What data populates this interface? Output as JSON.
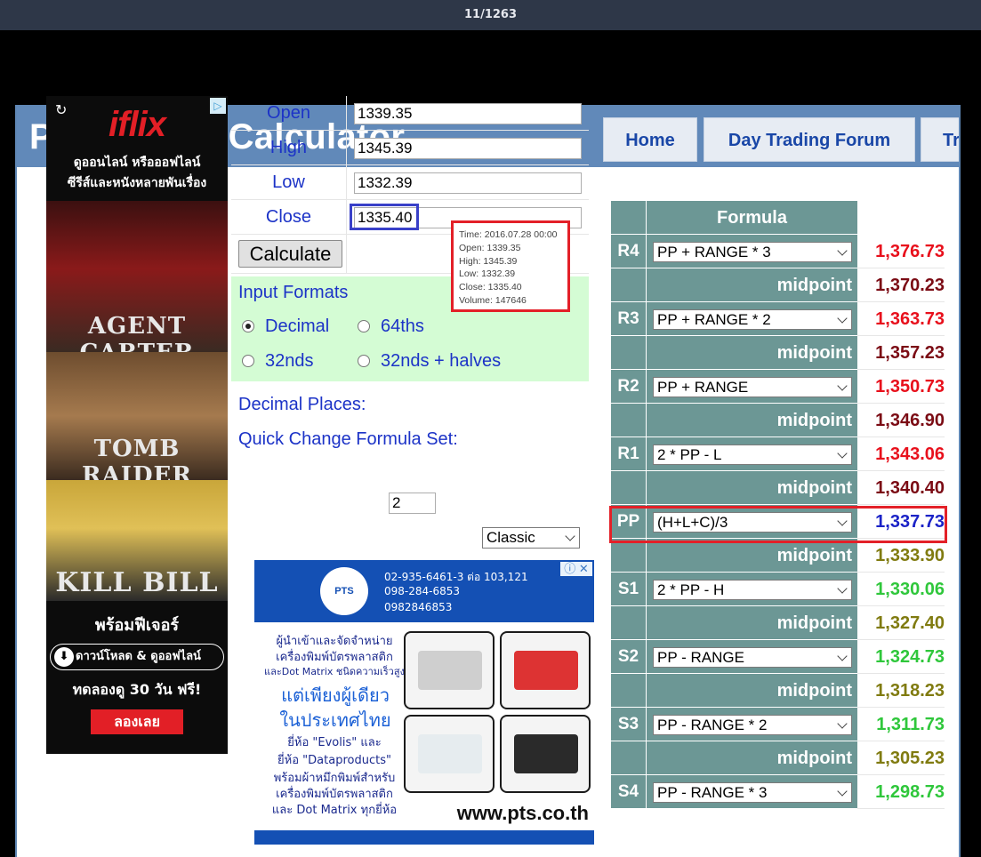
{
  "viewer": {
    "counter": "11/1263"
  },
  "site": {
    "title": "Pivot Point Calculator",
    "nav": [
      "Home",
      "Day Trading Forum",
      "Tr"
    ]
  },
  "inputs": {
    "open_label": "Open",
    "open_value": "1339.35",
    "high_label": "High",
    "high_value": "1345.39",
    "low_label": "Low",
    "low_value": "1332.39",
    "close_label": "Close",
    "close_value": "1335.40",
    "calculate_label": "Calculate"
  },
  "formats": {
    "title": "Input Formats",
    "options": [
      "Decimal",
      "64ths",
      "32nds",
      "32nds + halves"
    ],
    "selected": "Decimal",
    "decimal_places_label": "Decimal Places:",
    "decimal_places_value": "2",
    "quick_change_label": "Quick Change Formula Set:",
    "quick_change_value": "Classic"
  },
  "tooltip": {
    "time": "Time: 2016.07.28 00:00",
    "open": "Open: 1339.35",
    "high": "High: 1345.39",
    "low": "Low:  1332.39",
    "close": "Close: 1335.40",
    "volume": "Volume: 147646"
  },
  "pivot": {
    "header": "Formula",
    "midpoint_label": "midpoint",
    "rows": [
      {
        "key": "R4",
        "formula": "PP + RANGE * 3",
        "value": "1,376.73",
        "color": "#e8101c"
      },
      {
        "key": "",
        "formula": "",
        "value": "1,370.23",
        "color": "#7b0b14"
      },
      {
        "key": "R3",
        "formula": "PP + RANGE * 2",
        "value": "1,363.73",
        "color": "#e8101c"
      },
      {
        "key": "",
        "formula": "",
        "value": "1,357.23",
        "color": "#7b0b14"
      },
      {
        "key": "R2",
        "formula": "PP + RANGE",
        "value": "1,350.73",
        "color": "#e8101c"
      },
      {
        "key": "",
        "formula": "",
        "value": "1,346.90",
        "color": "#7b0b14"
      },
      {
        "key": "R1",
        "formula": "2 * PP - L",
        "value": "1,343.06",
        "color": "#e8101c"
      },
      {
        "key": "",
        "formula": "",
        "value": "1,340.40",
        "color": "#7b0b14"
      },
      {
        "key": "PP",
        "formula": "(H+L+C)/3",
        "value": "1,337.73",
        "color": "#1b23c7"
      },
      {
        "key": "",
        "formula": "",
        "value": "1,333.90",
        "color": "#807b10"
      },
      {
        "key": "S1",
        "formula": "2 * PP - H",
        "value": "1,330.06",
        "color": "#2fc73b"
      },
      {
        "key": "",
        "formula": "",
        "value": "1,327.40",
        "color": "#807b10"
      },
      {
        "key": "S2",
        "formula": "PP - RANGE",
        "value": "1,324.73",
        "color": "#2fc73b"
      },
      {
        "key": "",
        "formula": "",
        "value": "1,318.23",
        "color": "#807b10"
      },
      {
        "key": "S3",
        "formula": "PP - RANGE * 2",
        "value": "1,311.73",
        "color": "#2fc73b"
      },
      {
        "key": "",
        "formula": "",
        "value": "1,305.23",
        "color": "#807b10"
      },
      {
        "key": "S4",
        "formula": "PP - RANGE * 3",
        "value": "1,298.73",
        "color": "#2fc73b"
      }
    ]
  },
  "ad_iflix": {
    "brand": "iflix",
    "line1": "ดูออนไลน์ หรือออฟไลน์",
    "line2": "ซีรีส์และหนังหลายพันเรื่อง",
    "poster1": "AGENT CARTER",
    "poster2": "TOMB RAIDER",
    "poster3": "KILL BILL",
    "cta": "พร้อมฟีเจอร์",
    "download": "ดาวน์โหลด & ดูออฟไลน์",
    "trial": "ทดลองดู 30 วัน ฟรี!",
    "try_button": "ลองเลย"
  },
  "ad_pts": {
    "logo": "PTS",
    "phone1": "02-935-6461-3 ต่อ 103,121",
    "phone2": "098-284-6853",
    "phone3": "0982846853",
    "text1": "ผู้นำเข้าและจัดจำหน่าย",
    "text2": "เครื่องพิมพ์บัตรพลาสติก",
    "text3": "และDot Matrix ชนิดความเร็วสูง",
    "big1": "แต่เพียงผู้เดียว",
    "big2": "ในประเทศไทย",
    "text4": "ยี่ห้อ \"Evolis\" และ",
    "text5": "ยี่ห้อ \"Dataproducts\"",
    "text6": "พร้อมผ้าหมึกพิมพ์สำหรับ",
    "text7": "เครื่องพิมพ์บัตรพลาสติก",
    "text8": "และ Dot Matrix ทุกยี่ห้อ",
    "url": "www.pts.co.th"
  }
}
